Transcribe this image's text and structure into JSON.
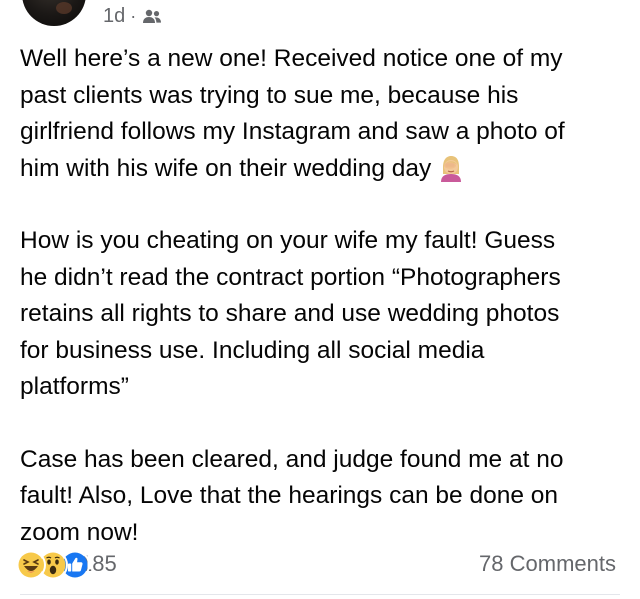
{
  "post": {
    "timestamp": "1d",
    "separator": "·",
    "audience_icon": "friends-icon",
    "paragraphs": [
      {
        "lines": [
          "Well here’s a new one! Received notice one of my",
          "past clients was trying to sue me, because his",
          "girlfriend follows my Instagram and saw a photo of",
          "him with his wife on their wedding day"
        ],
        "trailing_emoji": "woman-facepalming-emoji"
      },
      {
        "lines": [
          "How is you cheating on your wife my fault! Guess",
          "he didn’t read the contract portion “Photographers",
          "retains all rights to share and use wedding photos",
          "for business use. Including all social media",
          "platforms”"
        ]
      },
      {
        "lines": [
          "Case has been cleared, and judge found me at no",
          "fault! Also, Love that the hearings can be done on",
          "zoom now!"
        ]
      }
    ],
    "reactions": {
      "icons": [
        "haha-icon",
        "wow-icon",
        "like-icon"
      ],
      "count": "185"
    },
    "comments": "78 Comments"
  },
  "colors": {
    "text": "#050505",
    "secondary_text": "#65676b",
    "like_blue": "#1877f2",
    "reaction_yellow": "#f7c94a",
    "divider": "#e4e6eb"
  }
}
